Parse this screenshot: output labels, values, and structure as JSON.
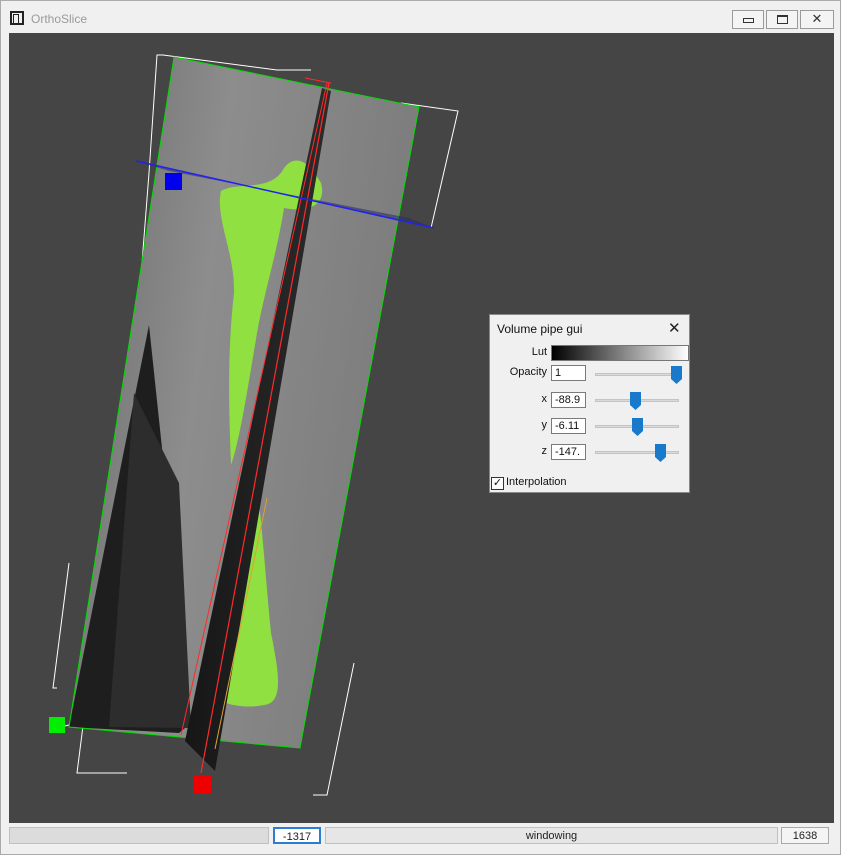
{
  "window": {
    "title": "OrthoSlice",
    "icons": {
      "app": "window-app-icon",
      "minimize": "minimize-icon",
      "maximize": "maximize-icon",
      "close": "close-icon"
    }
  },
  "gui": {
    "title": "Volume pipe gui",
    "close_icon": "close-icon",
    "lut_label": "Lut",
    "opacity": {
      "label": "Opacity",
      "value": "1",
      "slider": 0.97
    },
    "x": {
      "label": "x",
      "value": "-88.9",
      "slider": 0.48
    },
    "y": {
      "label": "y",
      "value": "-6.11",
      "slider": 0.5
    },
    "z": {
      "label": "z",
      "value": "-147.",
      "slider": 0.78
    },
    "interpolation": {
      "label": "Interpolation",
      "checked": true
    }
  },
  "status": {
    "window_min": "-1317",
    "mode": "windowing",
    "window_max": "1638"
  },
  "colors": {
    "viewport_bg": "#454545",
    "slider_thumb": "#1979ca",
    "segmentation": "#88dd3a",
    "plane_x": "#ff0000",
    "plane_y": "#00cc00",
    "plane_z": "#0000ff"
  }
}
